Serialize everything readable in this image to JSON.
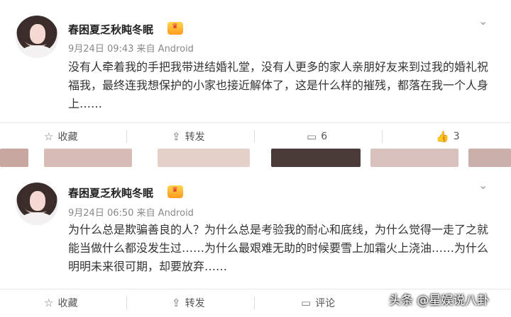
{
  "posts": [
    {
      "author": "春困夏乏秋盹冬眠",
      "badge_icon": "vip-crown-icon",
      "meta": "9月24日 09:43 来自 Android",
      "text": "没有人牵着我的手把我带进结婚礼堂，没有人更多的家人亲朋好友来到过我的婚礼祝福我，最终连我想保护的小家也接近解体了，这是什么样的摧残，都落在我一个人身上……",
      "actions": {
        "favorite": "收藏",
        "repost": "转发",
        "comment": "6",
        "like": "3"
      }
    },
    {
      "author": "春困夏乏秋盹冬眠",
      "badge_icon": "vip-crown-icon",
      "meta": "9月24日 06:50 来自 Android",
      "text": "为什么总是欺骗善良的人？为什么总是考验我的耐心和底线，为什么觉得一走了之就能当做什么都没发生过……为什么最艰难无助的时候要雪上加霜火上浇油……为什么明明未来很可期，却要放弃……",
      "actions": {
        "favorite": "收藏",
        "repost": "转发",
        "comment": "评论"
      }
    }
  ],
  "watermark": "头条 @星娱说八卦"
}
